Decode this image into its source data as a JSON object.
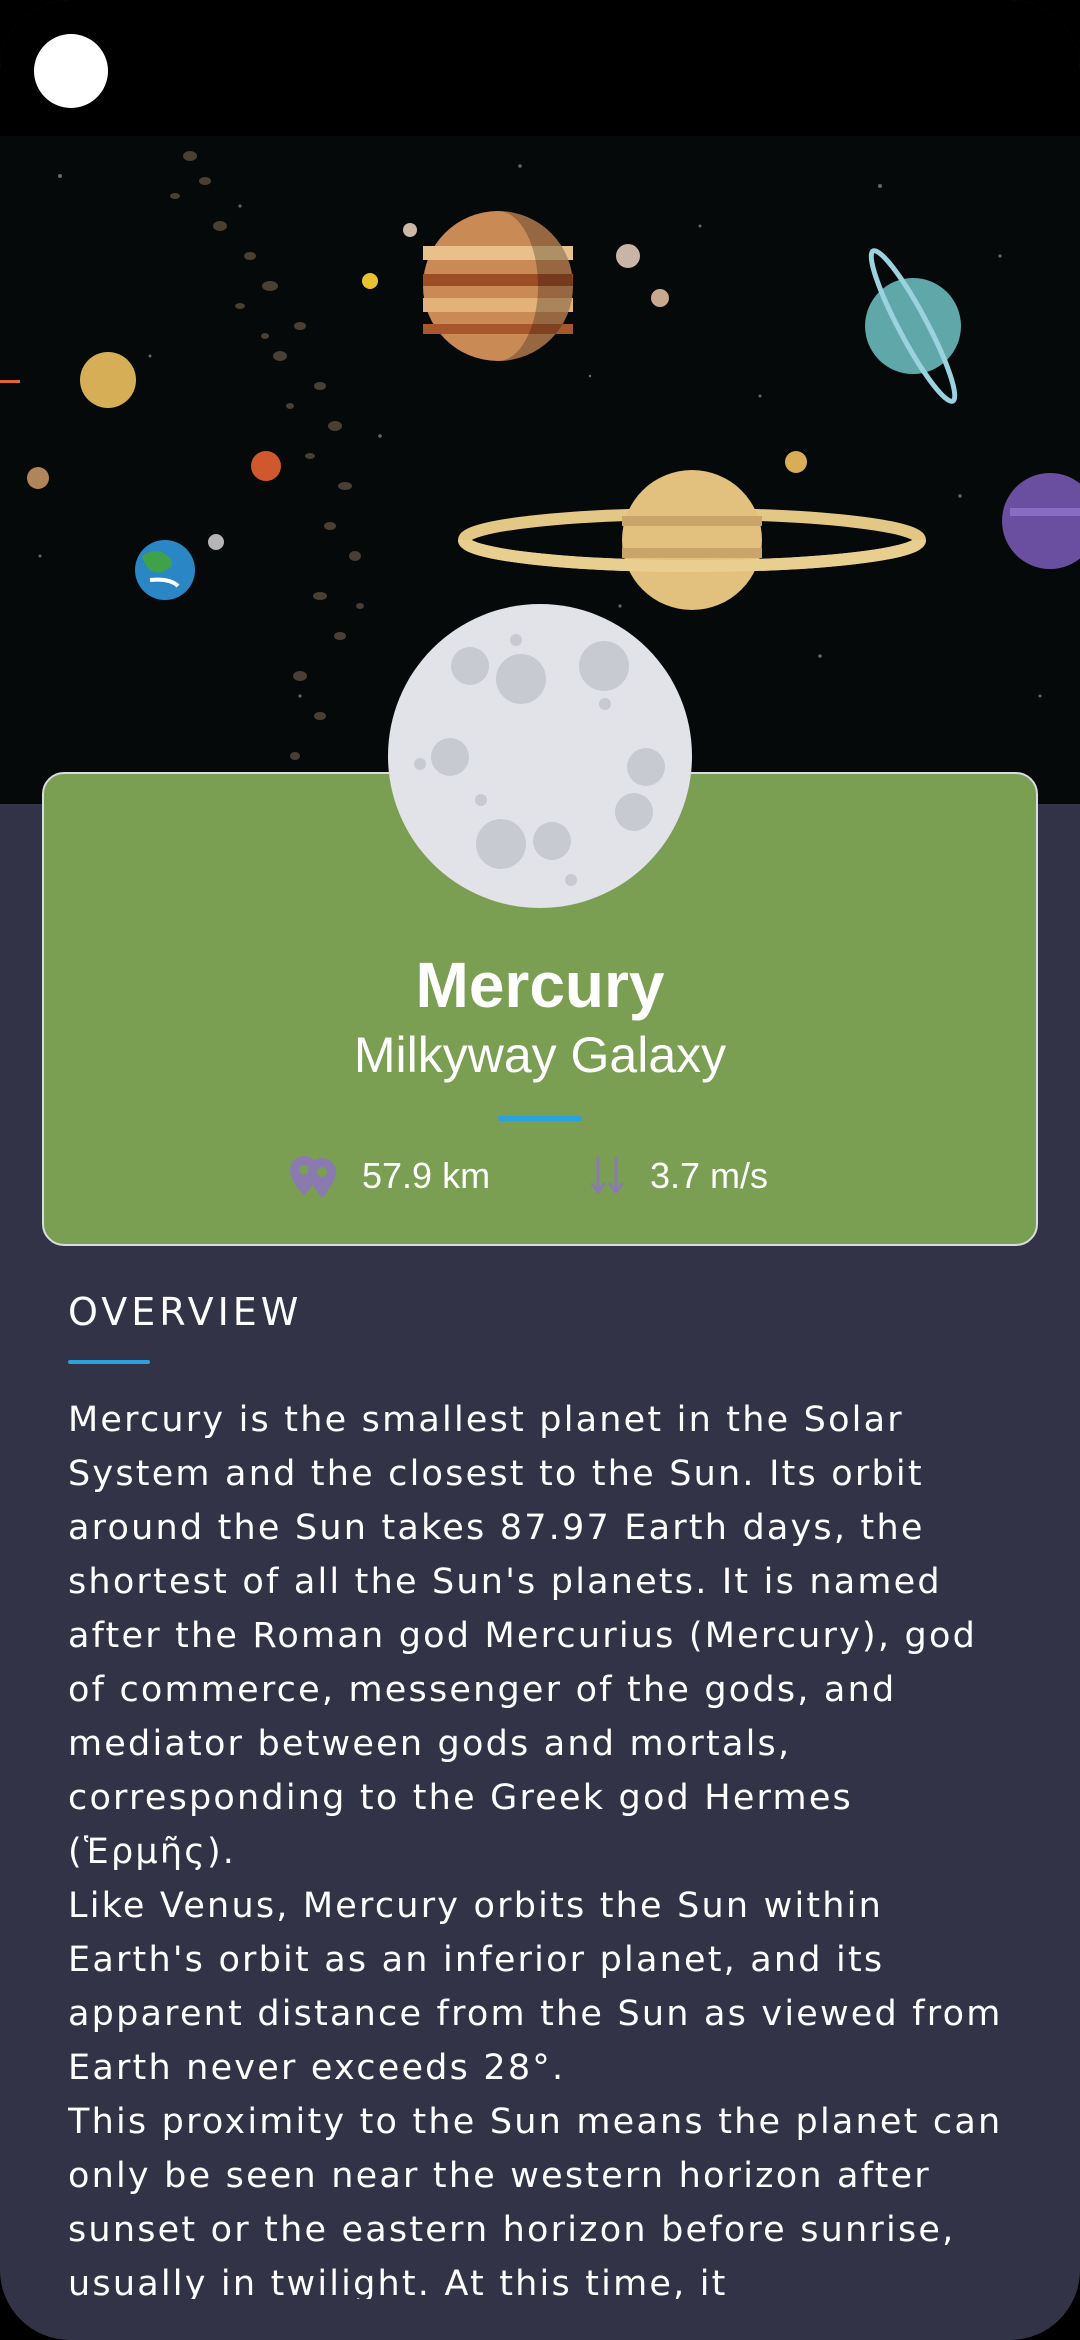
{
  "hero": {
    "image": "solar-system-illustration"
  },
  "planet": {
    "name": "Mercury",
    "galaxy": "Milkyway Galaxy",
    "image": "mercury-moon-illustration"
  },
  "stats": {
    "distance": {
      "icon": "location-pins-icon",
      "value": "57.9 km"
    },
    "gravity": {
      "icon": "down-arrows-icon",
      "value": "3.7 m/s"
    }
  },
  "overview": {
    "title": "OVERVIEW",
    "text": "Mercury is the smallest planet in the Solar System and the closest to the Sun. Its orbit around the Sun takes 87.97 Earth days, the shortest of all the Sun's planets. It is named after the Roman god Mercurius (Mercury), god of commerce, messenger of the gods, and mediator between gods and mortals, corresponding to the Greek god Hermes (Ἑρμῆς).\nLike Venus, Mercury orbits the Sun within Earth's orbit as an inferior planet, and its apparent distance from the Sun as viewed from Earth never exceeds 28°.\nThis proximity to the Sun means the planet can only be seen near the western horizon after sunset or the eastern horizon before sunrise, usually in twilight. At this time, it"
  },
  "colors": {
    "background": "#323346",
    "card": "#7a9e52",
    "accent": "#2aa3dc",
    "icon": "#8b7ab0"
  }
}
